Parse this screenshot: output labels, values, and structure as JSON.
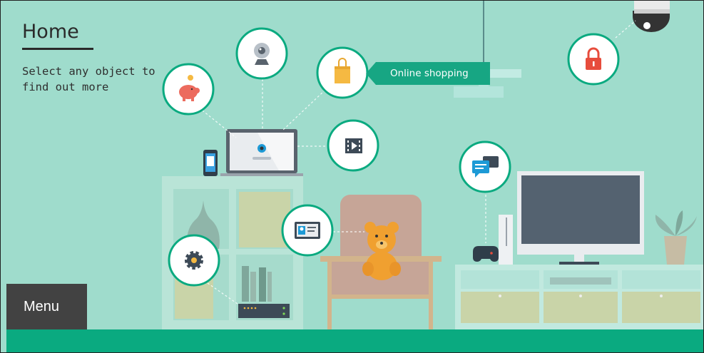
{
  "page": {
    "title": "Home",
    "subtitle": "Select any object to find out more"
  },
  "tooltip": {
    "label": "Online shopping"
  },
  "menu": {
    "label": "Menu"
  },
  "hotspots": [
    {
      "name": "savings-hotspot",
      "icon": "piggy-bank-icon"
    },
    {
      "name": "webcam-hotspot",
      "icon": "webcam-icon"
    },
    {
      "name": "online-shopping-hotspot",
      "icon": "shopping-bag-icon"
    },
    {
      "name": "security-hotspot",
      "icon": "padlock-icon"
    },
    {
      "name": "video-streaming-hotspot",
      "icon": "film-icon"
    },
    {
      "name": "messaging-hotspot",
      "icon": "chat-bubbles-icon"
    },
    {
      "name": "identity-hotspot",
      "icon": "id-card-icon"
    },
    {
      "name": "settings-hotspot",
      "icon": "gear-icon"
    }
  ],
  "colors": {
    "background": "#9fdccc",
    "accent": "#0aaa80",
    "tooltip": "#17a683",
    "menu": "#424242",
    "title": "#2a2a2a"
  }
}
